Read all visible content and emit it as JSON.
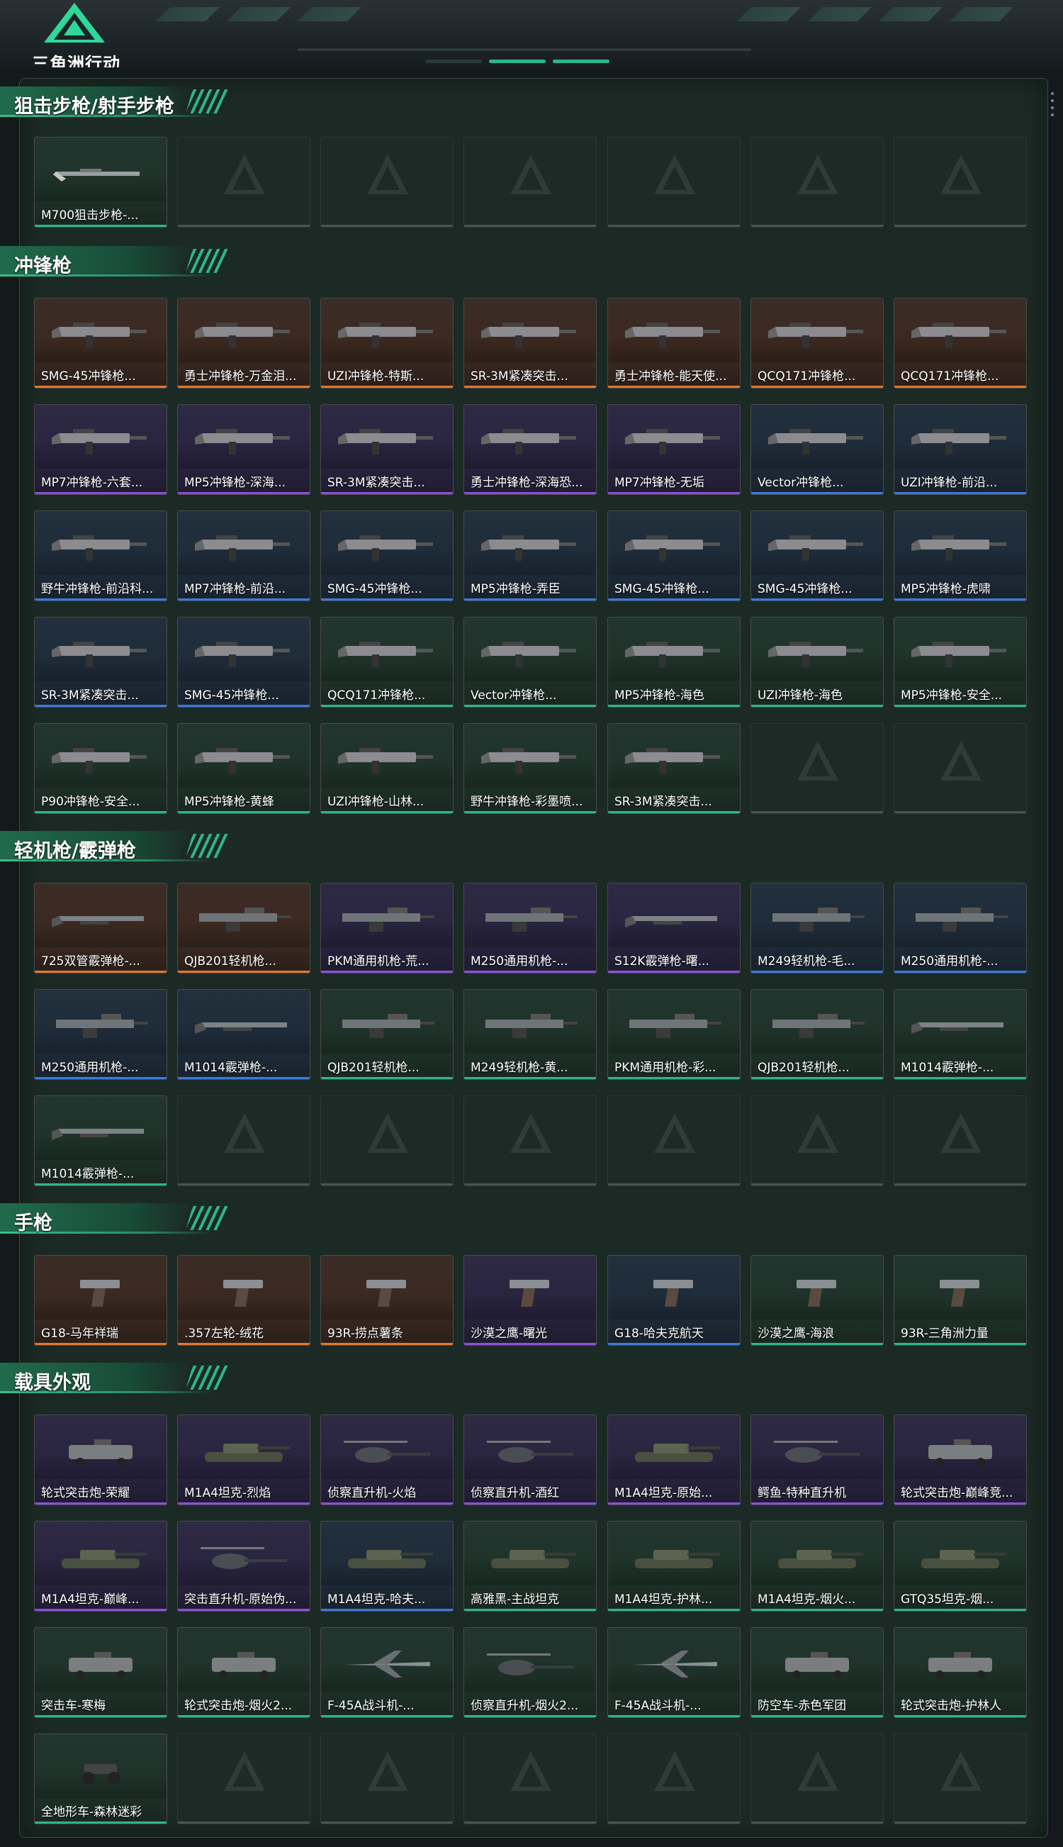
{
  "game_title": "三角洲行动",
  "colors": {
    "accent": "#2fb58b",
    "rarity_orange": "#e0782f",
    "rarity_purple": "#8a4fe0",
    "rarity_blue": "#3a7ae0",
    "rarity_green": "#2fb58b"
  },
  "sections": [
    {
      "title": "狙击步枪/射手步枪",
      "rows": [
        [
          {
            "name": "M700狙击步枪-...",
            "rarity": "green",
            "icon": "rifle"
          },
          null,
          null,
          null,
          null,
          null,
          null
        ]
      ]
    },
    {
      "title": "冲锋枪",
      "rows": [
        [
          {
            "name": "SMG-45冲锋枪...",
            "rarity": "orange",
            "icon": "smg"
          },
          {
            "name": "勇士冲锋枪-万金泪...",
            "rarity": "orange",
            "icon": "smg"
          },
          {
            "name": "UZI冲锋枪-特斯...",
            "rarity": "orange",
            "icon": "smg"
          },
          {
            "name": "SR-3M紧凑突击...",
            "rarity": "orange",
            "icon": "smg"
          },
          {
            "name": "勇士冲锋枪-能天使...",
            "rarity": "orange",
            "icon": "smg"
          },
          {
            "name": "QCQ171冲锋枪...",
            "rarity": "orange",
            "icon": "smg"
          },
          {
            "name": "QCQ171冲锋枪...",
            "rarity": "orange",
            "icon": "smg"
          }
        ],
        [
          {
            "name": "MP7冲锋枪-六套...",
            "rarity": "purple",
            "icon": "smg"
          },
          {
            "name": "MP5冲锋枪-深海...",
            "rarity": "purple",
            "icon": "smg"
          },
          {
            "name": "SR-3M紧凑突击...",
            "rarity": "purple",
            "icon": "smg"
          },
          {
            "name": "勇士冲锋枪-深海恐...",
            "rarity": "purple",
            "icon": "smg"
          },
          {
            "name": "MP7冲锋枪-无垢",
            "rarity": "purple",
            "icon": "smg"
          },
          {
            "name": "Vector冲锋枪...",
            "rarity": "blue",
            "icon": "smg"
          },
          {
            "name": "UZI冲锋枪-前沿...",
            "rarity": "blue",
            "icon": "smg"
          }
        ],
        [
          {
            "name": "野牛冲锋枪-前沿科...",
            "rarity": "blue",
            "icon": "smg"
          },
          {
            "name": "MP7冲锋枪-前沿...",
            "rarity": "blue",
            "icon": "smg"
          },
          {
            "name": "SMG-45冲锋枪...",
            "rarity": "blue",
            "icon": "smg"
          },
          {
            "name": "MP5冲锋枪-弄臣",
            "rarity": "blue",
            "icon": "smg"
          },
          {
            "name": "SMG-45冲锋枪...",
            "rarity": "blue",
            "icon": "smg"
          },
          {
            "name": "SMG-45冲锋枪...",
            "rarity": "blue",
            "icon": "smg"
          },
          {
            "name": "MP5冲锋枪-虎啸",
            "rarity": "blue",
            "icon": "smg"
          }
        ],
        [
          {
            "name": "SR-3M紧凑突击...",
            "rarity": "blue",
            "icon": "smg"
          },
          {
            "name": "SMG-45冲锋枪...",
            "rarity": "blue",
            "icon": "smg"
          },
          {
            "name": "QCQ171冲锋枪...",
            "rarity": "green",
            "icon": "smg"
          },
          {
            "name": "Vector冲锋枪...",
            "rarity": "green",
            "icon": "smg"
          },
          {
            "name": "MP5冲锋枪-海色",
            "rarity": "green",
            "icon": "smg"
          },
          {
            "name": "UZI冲锋枪-海色",
            "rarity": "green",
            "icon": "smg"
          },
          {
            "name": "MP5冲锋枪-安全...",
            "rarity": "green",
            "icon": "smg"
          }
        ],
        [
          {
            "name": "P90冲锋枪-安全...",
            "rarity": "green",
            "icon": "smg"
          },
          {
            "name": "MP5冲锋枪-黄蜂",
            "rarity": "green",
            "icon": "smg"
          },
          {
            "name": "UZI冲锋枪-山林...",
            "rarity": "green",
            "icon": "smg"
          },
          {
            "name": "野牛冲锋枪-彩墨喷...",
            "rarity": "green",
            "icon": "smg"
          },
          {
            "name": "SR-3M紧凑突击...",
            "rarity": "green",
            "icon": "smg"
          },
          null,
          null
        ]
      ]
    },
    {
      "title": "轻机枪/霰弹枪",
      "rows": [
        [
          {
            "name": "725双管霰弹枪-...",
            "rarity": "orange",
            "icon": "shotgun"
          },
          {
            "name": "QJB201轻机枪...",
            "rarity": "orange",
            "icon": "lmg"
          },
          {
            "name": "PKM通用机枪-荒...",
            "rarity": "purple",
            "icon": "lmg"
          },
          {
            "name": "M250通用机枪-...",
            "rarity": "purple",
            "icon": "lmg"
          },
          {
            "name": "S12K霰弹枪-曙...",
            "rarity": "purple",
            "icon": "shotgun"
          },
          {
            "name": "M249轻机枪-毛...",
            "rarity": "blue",
            "icon": "lmg"
          },
          {
            "name": "M250通用机枪-...",
            "rarity": "blue",
            "icon": "lmg"
          }
        ],
        [
          {
            "name": "M250通用机枪-...",
            "rarity": "blue",
            "icon": "lmg"
          },
          {
            "name": "M1014霰弹枪-...",
            "rarity": "blue",
            "icon": "shotgun"
          },
          {
            "name": "QJB201轻机枪...",
            "rarity": "green",
            "icon": "lmg"
          },
          {
            "name": "M249轻机枪-黄...",
            "rarity": "green",
            "icon": "lmg"
          },
          {
            "name": "PKM通用机枪-彩...",
            "rarity": "green",
            "icon": "lmg"
          },
          {
            "name": "QJB201轻机枪...",
            "rarity": "green",
            "icon": "lmg"
          },
          {
            "name": "M1014霰弹枪-...",
            "rarity": "green",
            "icon": "shotgun"
          }
        ],
        [
          {
            "name": "M1014霰弹枪-...",
            "rarity": "green",
            "icon": "shotgun"
          },
          null,
          null,
          null,
          null,
          null,
          null
        ]
      ]
    },
    {
      "title": "手枪",
      "rows": [
        [
          {
            "name": "G18-马年祥瑞",
            "rarity": "orange",
            "icon": "pistol"
          },
          {
            "name": ".357左轮-绒花",
            "rarity": "orange",
            "icon": "pistol"
          },
          {
            "name": "93R-捞点薯条",
            "rarity": "orange",
            "icon": "pistol"
          },
          {
            "name": "沙漠之鹰-曙光",
            "rarity": "purple",
            "icon": "pistol"
          },
          {
            "name": "G18-哈夫克航天",
            "rarity": "blue",
            "icon": "pistol"
          },
          {
            "name": "沙漠之鹰-海浪",
            "rarity": "green",
            "icon": "pistol"
          },
          {
            "name": "93R-三角洲力量",
            "rarity": "green",
            "icon": "pistol"
          }
        ]
      ]
    },
    {
      "title": "载具外观",
      "rows": [
        [
          {
            "name": "轮式突击炮-荣耀",
            "rarity": "purple",
            "icon": "vehicle"
          },
          {
            "name": "M1A4坦克-烈焰",
            "rarity": "purple",
            "icon": "tank"
          },
          {
            "name": "侦察直升机-火焰",
            "rarity": "purple",
            "icon": "helicopter"
          },
          {
            "name": "侦察直升机-酒红",
            "rarity": "purple",
            "icon": "helicopter"
          },
          {
            "name": "M1A4坦克-原始...",
            "rarity": "purple",
            "icon": "tank"
          },
          {
            "name": "鳄鱼-特种直升机",
            "rarity": "purple",
            "icon": "helicopter"
          },
          {
            "name": "轮式突击炮-巅峰竞...",
            "rarity": "purple",
            "icon": "vehicle"
          }
        ],
        [
          {
            "name": "M1A4坦克-巅峰...",
            "rarity": "purple",
            "icon": "tank"
          },
          {
            "name": "突击直升机-原始伪...",
            "rarity": "purple",
            "icon": "helicopter"
          },
          {
            "name": "M1A4坦克-哈夫...",
            "rarity": "blue",
            "icon": "tank"
          },
          {
            "name": "高雅黑-主战坦克",
            "rarity": "green",
            "icon": "tank"
          },
          {
            "name": "M1A4坦克-护林...",
            "rarity": "green",
            "icon": "tank"
          },
          {
            "name": "M1A4坦克-烟火...",
            "rarity": "green",
            "icon": "tank"
          },
          {
            "name": "GTQ35坦克-烟...",
            "rarity": "green",
            "icon": "tank"
          }
        ],
        [
          {
            "name": "突击车-寒梅",
            "rarity": "green",
            "icon": "vehicle"
          },
          {
            "name": "轮式突击炮-烟火2...",
            "rarity": "green",
            "icon": "vehicle"
          },
          {
            "name": "F-45A战斗机-...",
            "rarity": "green",
            "icon": "jet"
          },
          {
            "name": "侦察直升机-烟火2...",
            "rarity": "green",
            "icon": "helicopter"
          },
          {
            "name": "F-45A战斗机-...",
            "rarity": "green",
            "icon": "jet"
          },
          {
            "name": "防空车-赤色军团",
            "rarity": "green",
            "icon": "vehicle"
          },
          {
            "name": "轮式突击炮-护林人",
            "rarity": "green",
            "icon": "vehicle"
          }
        ],
        [
          {
            "name": "全地形车-森林迷彩",
            "rarity": "green",
            "icon": "atv"
          },
          null,
          null,
          null,
          null,
          null,
          null
        ]
      ]
    }
  ]
}
